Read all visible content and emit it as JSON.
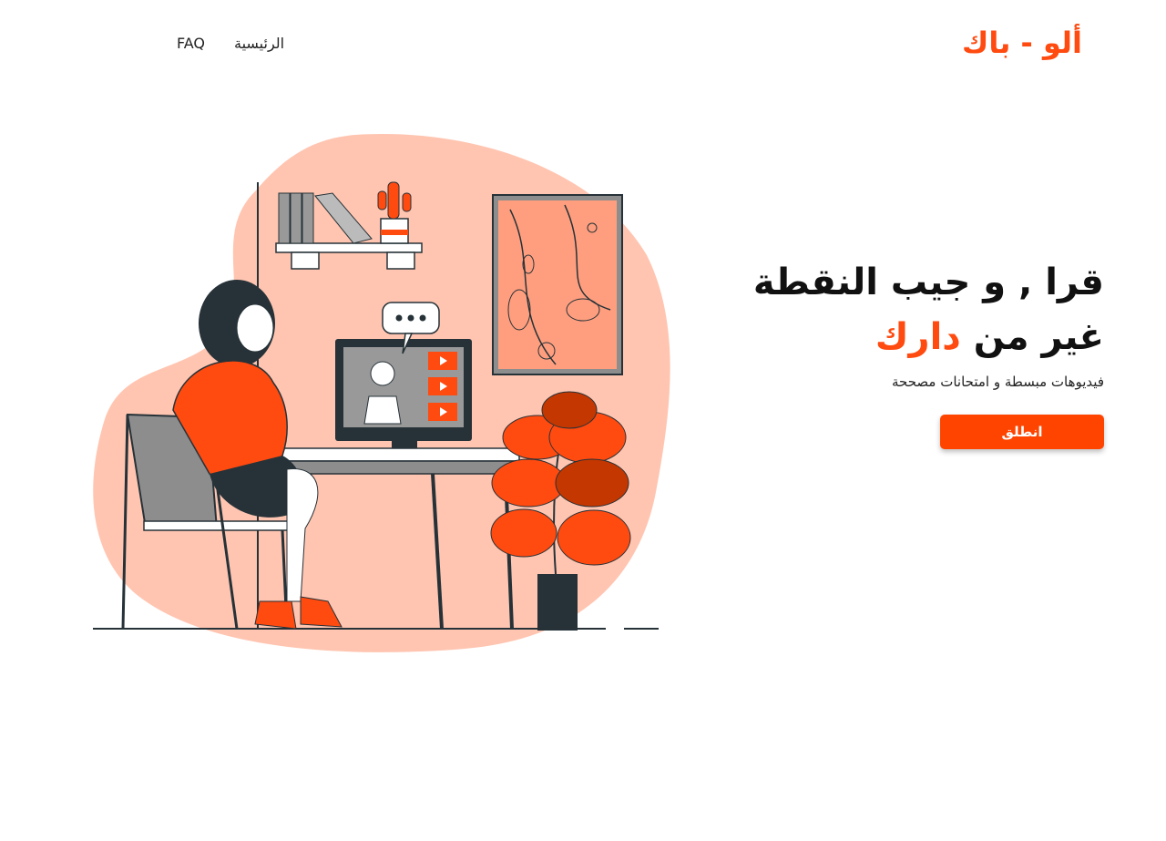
{
  "nav": {
    "links": [
      {
        "label": "FAQ"
      },
      {
        "label": "الرئيسية"
      }
    ]
  },
  "brand": {
    "logo": "ألو - باك"
  },
  "hero": {
    "line1": "قرا , و جيب النقطة",
    "line2_plain": "غير من",
    "line2_accent": "دارك",
    "subtitle": "فيديوهات مبسطة و امتحانات مصححة",
    "cta_label": "انطلق"
  },
  "colors": {
    "accent": "#ff4a10",
    "blob": "#ffc5b1",
    "dark": "#263238"
  },
  "illustration": {
    "icon": "student-online-learning-illustration"
  }
}
